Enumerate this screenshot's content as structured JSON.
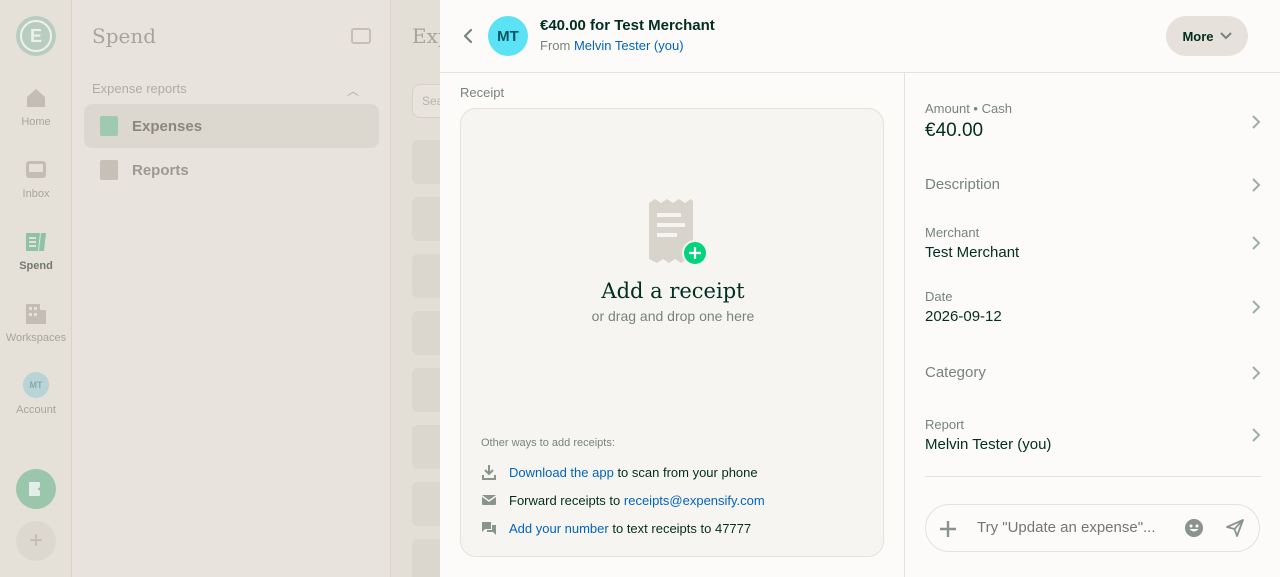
{
  "nav": {
    "items": [
      {
        "label": "Home"
      },
      {
        "label": "Inbox"
      },
      {
        "label": "Spend"
      },
      {
        "label": "Workspaces"
      },
      {
        "label": "Account"
      }
    ],
    "account_initials": "MT",
    "active": "Spend"
  },
  "sidebar": {
    "title": "Spend",
    "section": "Expense reports",
    "items": [
      {
        "label": "Expenses",
        "active": true
      },
      {
        "label": "Reports",
        "active": false
      }
    ]
  },
  "background_list": {
    "title": "Expenses",
    "search_placeholder": "Search"
  },
  "panel": {
    "avatar_initials": "MT",
    "title": "€40.00 for Test Merchant",
    "from_prefix": "From",
    "from_name": "Melvin Tester (you)",
    "more_label": "More"
  },
  "receipt": {
    "label": "Receipt",
    "title": "Add a receipt",
    "subtitle": "or drag and drop one here",
    "other_ways_label": "Other ways to add receipts:",
    "download_link": "Download the app",
    "download_rest": "to scan from your phone",
    "forward_text": "Forward receipts to",
    "forward_email": "receipts@expensify.com",
    "number_link": "Add your number",
    "number_rest": "to text receipts to 47777"
  },
  "details": {
    "amount_label": "Amount • Cash",
    "amount_value": "€40.00",
    "description_label": "Description",
    "merchant_label": "Merchant",
    "merchant_value": "Test Merchant",
    "date_label": "Date",
    "date_value": "2026-09-12",
    "category_label": "Category",
    "report_label": "Report",
    "report_value": "Melvin Tester (you)"
  },
  "composer": {
    "placeholder": "Try \"Update an expense\"..."
  },
  "colors": {
    "accent_green": "#03d47c",
    "link_blue": "#0164bf",
    "avatar_cyan": "#5ce2f5",
    "text_dark": "#002e22"
  }
}
